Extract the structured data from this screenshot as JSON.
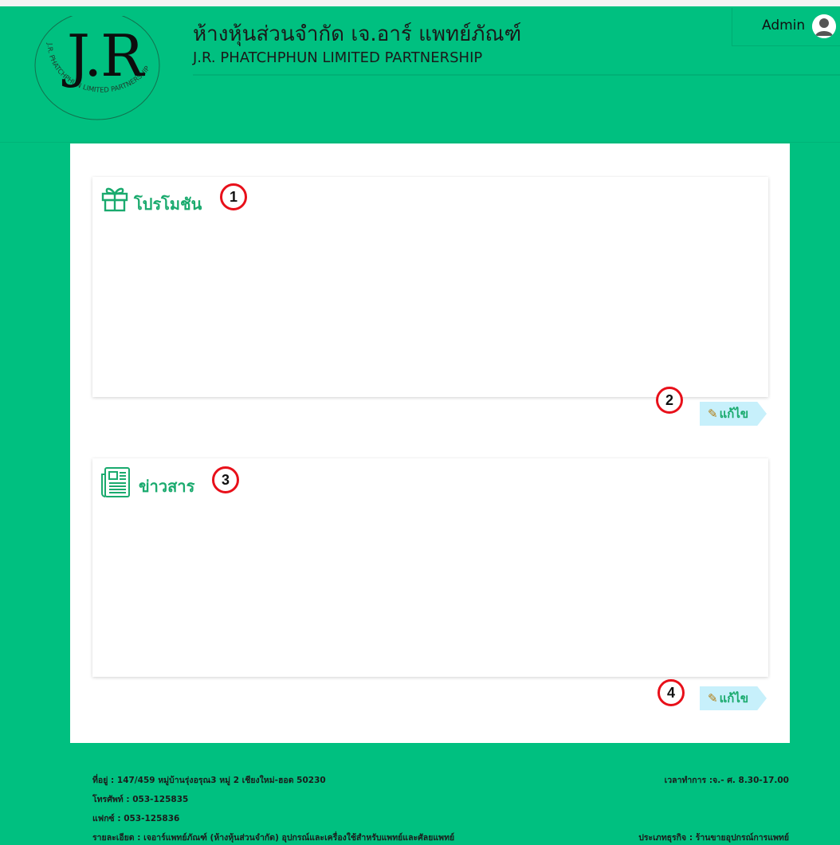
{
  "header": {
    "logo_text": "J.R",
    "logo_ring_text": "J.R. PHATCHPHUN LIMITED PARTNERSHIP",
    "title_th": "ห้างหุ้นส่วนจำกัด เจ.อาร์ แพทย์ภัณฑ์",
    "title_en": "J.R. PHATCHPHUN LIMITED PARTNERSHIP",
    "user_label": "Admin"
  },
  "promo": {
    "title": "โปรโมชัน",
    "badge": "1",
    "edit_badge": "2",
    "edit_label": "แก้ไข"
  },
  "news": {
    "title": "ข่าวสาร",
    "badge": "3",
    "edit_badge": "4",
    "edit_label": "แก้ไข"
  },
  "footer": {
    "address": "ที่อยู่ : 147/459 หมู่บ้านรุ่งอรุณ3 หมู่ 2 เชียงใหม่-ฮอด 50230",
    "phone": "โทรศัพท์ : 053-125835",
    "fax": "แฟกซ์ : 053-125836",
    "details": "รายละเอียด : เจอาร์แพทย์ภัณฑ์ (ห้างหุ้นส่วนจำกัด) อุปกรณ์และเครื่องใช้สำหรับแพทย์และศัลยแพทย์",
    "hours": "เวลาทำการ :จ.- ศ. 8.30-17.00",
    "business_type": "ประเภทธุรกิจ : ร้านขายอุปกรณ์การแพทย์"
  },
  "colors": {
    "background": "#00c080",
    "accent_green": "#1aaa6e",
    "badge_red": "#e8101a",
    "edit_button_bg": "#c7f0fb"
  }
}
